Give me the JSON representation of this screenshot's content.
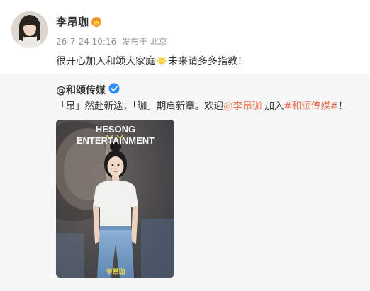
{
  "post": {
    "username": "李昂珈",
    "timestamp": "26-7-24 10:16",
    "location": "发布于 北京",
    "content_before": "很开心加入和颂大家庭",
    "content_after": "未来请多多指教！",
    "badge_icon": "crown-badge-icon",
    "emoji_icon": "sun-emoji-icon"
  },
  "repost": {
    "author": "@和颂传媒",
    "verified_icon": "verified-icon",
    "text_part1": "「昂」然赴新途，「珈」期启新章。欢迎",
    "mention": "@李昂珈",
    "text_part2": " 加入",
    "hashtag": "#和颂传媒#",
    "text_part3": "！",
    "link_color": "#eb7350",
    "poster": {
      "brand_line1": "HESONG",
      "brand_line2": "ENTERTAINMENT",
      "name_tag": "李昂珈"
    }
  }
}
